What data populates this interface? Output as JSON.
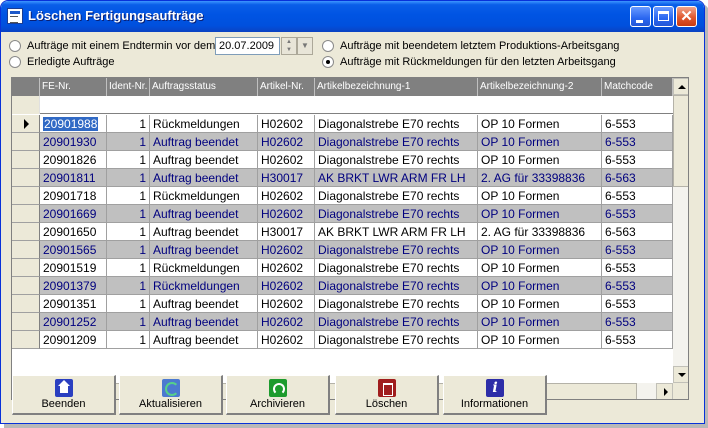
{
  "window": {
    "title": "Löschen Fertigungsaufträge"
  },
  "filters": {
    "option_enddate": "Aufträge mit einem Endtermin vor dem",
    "option_done": "Erledigte Aufträge",
    "option_finished_last_step": "Aufträge mit beendetem letztem Produktions-Arbeitsgang",
    "option_feedback_last_step": "Aufträge mit Rückmeldungen für den letzten Arbeitsgang",
    "date_value": "20.07.2009",
    "selected_left": "none",
    "selected_right": "option_feedback_last_step"
  },
  "grid": {
    "columns": [
      "FE-Nr.",
      "Ident-Nr.",
      "Auftragsstatus",
      "Artikel-Nr.",
      "Artikelbezeichnung-1",
      "Artikelbezeichnung-2",
      "Matchcode"
    ],
    "rows": [
      [
        "20901988",
        "1",
        "Rückmeldungen",
        "H02602",
        "Diagonalstrebe E70 rechts",
        "OP 10 Formen",
        "6-553"
      ],
      [
        "20901930",
        "1",
        "Auftrag beendet",
        "H02602",
        "Diagonalstrebe E70 rechts",
        "OP 10 Formen",
        "6-553"
      ],
      [
        "20901826",
        "1",
        "Auftrag beendet",
        "H02602",
        "Diagonalstrebe E70 rechts",
        "OP 10 Formen",
        "6-553"
      ],
      [
        "20901811",
        "1",
        "Auftrag beendet",
        "H30017",
        "AK BRKT LWR ARM FR LH",
        "2. AG für 33398836",
        "6-563"
      ],
      [
        "20901718",
        "1",
        "Rückmeldungen",
        "H02602",
        "Diagonalstrebe E70 rechts",
        "OP 10 Formen",
        "6-553"
      ],
      [
        "20901669",
        "1",
        "Auftrag beendet",
        "H02602",
        "Diagonalstrebe E70 rechts",
        "OP 10 Formen",
        "6-553"
      ],
      [
        "20901650",
        "1",
        "Auftrag beendet",
        "H30017",
        "AK BRKT LWR ARM FR LH",
        "2. AG für 33398836",
        "6-563"
      ],
      [
        "20901565",
        "1",
        "Auftrag beendet",
        "H02602",
        "Diagonalstrebe E70 rechts",
        "OP 10 Formen",
        "6-553"
      ],
      [
        "20901519",
        "1",
        "Rückmeldungen",
        "H02602",
        "Diagonalstrebe E70 rechts",
        "OP 10 Formen",
        "6-553"
      ],
      [
        "20901379",
        "1",
        "Rückmeldungen",
        "H02602",
        "Diagonalstrebe E70 rechts",
        "OP 10 Formen",
        "6-553"
      ],
      [
        "20901351",
        "1",
        "Auftrag beendet",
        "H02602",
        "Diagonalstrebe E70 rechts",
        "OP 10 Formen",
        "6-553"
      ],
      [
        "20901252",
        "1",
        "Auftrag beendet",
        "H02602",
        "Diagonalstrebe E70 rechts",
        "OP 10 Formen",
        "6-553"
      ],
      [
        "20901209",
        "1",
        "Auftrag beendet",
        "H02602",
        "Diagonalstrebe E70 rechts",
        "OP 10 Formen",
        "6-553"
      ]
    ],
    "selected_row": 0
  },
  "buttons": {
    "close": "Beenden",
    "refresh": "Aktualisieren",
    "archive": "Archivieren",
    "delete": "Löschen",
    "info": "Informationen"
  },
  "icons": {
    "close": "home-icon",
    "refresh": "refresh-icon",
    "archive": "recycle-icon",
    "delete": "trash-icon",
    "info": "info-icon"
  },
  "colors": {
    "titlebar": "#0054e3",
    "alt_row_text": "#00007f",
    "alt_row_bg": "#c0c0c0"
  }
}
